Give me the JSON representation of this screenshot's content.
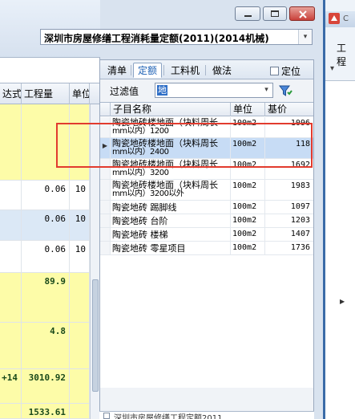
{
  "window": {
    "quota_set_label": "深圳市房屋修缮工程消耗量定额(2011)(2014机械)",
    "dropdown_arrow": "▾"
  },
  "left_grid": {
    "headers": [
      "达式",
      "工程量",
      "单位"
    ],
    "rows": [
      {
        "expr": "",
        "qty": "",
        "unit": "",
        "style": "yellow"
      },
      {
        "expr": "",
        "qty": "0.06",
        "unit": "10",
        "style": "white"
      },
      {
        "expr": "",
        "qty": "0.06",
        "unit": "10",
        "style": "blue"
      },
      {
        "expr": "",
        "qty": "0.06",
        "unit": "10",
        "style": "white"
      },
      {
        "expr": "",
        "qty": "89.9",
        "unit": "",
        "style": "yellow"
      },
      {
        "expr": "",
        "qty": "4.8",
        "unit": "",
        "style": "yellow"
      },
      {
        "expr": "+14",
        "qty": "3010.92",
        "unit": "",
        "style": "yellow"
      },
      {
        "expr": "",
        "qty": "1533.61",
        "unit": "",
        "style": "yellow"
      }
    ]
  },
  "panel": {
    "tabs": [
      "清单",
      "定额",
      "工料机",
      "做法"
    ],
    "active_tab": 1,
    "locate_label": "定位",
    "filter_label": "过滤值",
    "filter_value": "地",
    "columns": [
      "子目名称",
      "单位",
      "基价"
    ],
    "rows": [
      {
        "name1": "陶瓷地砖楼地面（块料周长",
        "name2": "mm以内）1200",
        "unit": "100m2",
        "price": "1096"
      },
      {
        "name1": "陶瓷地砖楼地面（块料周长",
        "name2": "mm以内）2400",
        "unit": "100m2",
        "price": "118"
      },
      {
        "name1": "陶瓷地砖楼地面（块料周长",
        "name2": "mm以内）3200",
        "unit": "100m2",
        "price": "1692"
      },
      {
        "name1": "陶瓷地砖楼地面（块料周长",
        "name2": "mm以内）3200以外",
        "unit": "100m2",
        "price": "1983"
      },
      {
        "name1": "陶瓷地砖 踢脚线",
        "name2": "",
        "unit": "100m2",
        "price": "1097"
      },
      {
        "name1": "陶瓷地砖 台阶",
        "name2": "",
        "unit": "100m2",
        "price": "1203"
      },
      {
        "name1": "陶瓷地砖 楼梯",
        "name2": "",
        "unit": "100m2",
        "price": "1407"
      },
      {
        "name1": "陶瓷地砖 零星项目",
        "name2": "",
        "unit": "100m2",
        "price": "1736"
      }
    ],
    "selected_row": 1,
    "row_indicator": "▶",
    "tree_label": "深圳市房屋修缮工程定额2011"
  },
  "right_app": {
    "title_text": "C",
    "label": "工程",
    "toolbar": "▾"
  },
  "colors": {
    "highlight": "#e23b2e",
    "selected_row": "#c7dcf5",
    "yellow": "#fdfca8"
  }
}
